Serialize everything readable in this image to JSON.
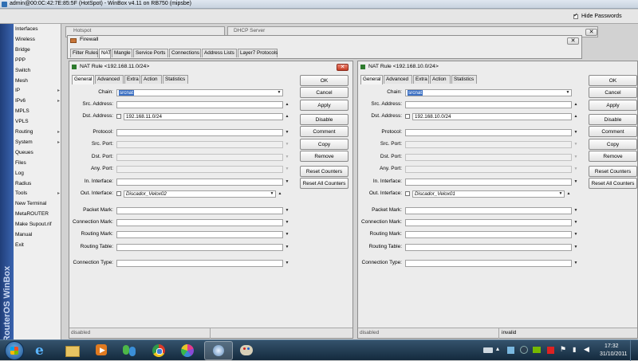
{
  "window": {
    "title": "admin@00:0C:42:7E:85:5F (HotSpot) - WinBox v4.11 on RB750 (mipsbe)",
    "hide_passwords": "Hide Passwords",
    "vertical_brand": "RouterOS WinBox"
  },
  "sidebar": {
    "items": [
      {
        "label": "Interfaces",
        "arrow": ""
      },
      {
        "label": "Wireless",
        "arrow": ""
      },
      {
        "label": "Bridge",
        "arrow": ""
      },
      {
        "label": "PPP",
        "arrow": ""
      },
      {
        "label": "Switch",
        "arrow": ""
      },
      {
        "label": "Mesh",
        "arrow": ""
      },
      {
        "label": "IP",
        "arrow": "▸"
      },
      {
        "label": "IPv6",
        "arrow": "▸"
      },
      {
        "label": "MPLS",
        "arrow": ""
      },
      {
        "label": "VPLS",
        "arrow": ""
      },
      {
        "label": "Routing",
        "arrow": "▸"
      },
      {
        "label": "System",
        "arrow": "▸"
      },
      {
        "label": "Queues",
        "arrow": ""
      },
      {
        "label": "Files",
        "arrow": ""
      },
      {
        "label": "Log",
        "arrow": ""
      },
      {
        "label": "Radius",
        "arrow": ""
      },
      {
        "label": "Tools",
        "arrow": "▸"
      },
      {
        "label": "New Terminal",
        "arrow": ""
      },
      {
        "label": "MetaROUTER",
        "arrow": ""
      },
      {
        "label": "Make Supout.rif",
        "arrow": ""
      },
      {
        "label": "Manual",
        "arrow": ""
      },
      {
        "label": "Exit",
        "arrow": ""
      }
    ]
  },
  "bg_windows": {
    "hotspot": "Hotspot",
    "dhcp": "DHCP Server"
  },
  "firewall": {
    "title": "Firewall",
    "tabs": [
      "Filter Rules",
      "NAT",
      "Mangle",
      "Service Ports",
      "Connections",
      "Address Lists",
      "Layer7 Protocols"
    ]
  },
  "nat_left": {
    "title": "NAT Rule <192.168.11.0/24>",
    "tabs": [
      "General",
      "Advanced",
      "Extra",
      "Action",
      "Statistics"
    ],
    "fields": {
      "chain": "srcnat",
      "src_address": "",
      "dst_address": "192.168.11.0/24",
      "protocol": "",
      "src_port": "",
      "dst_port": "",
      "any_port": "",
      "in_interface": "",
      "out_interface": "Discador_Velox02",
      "packet_mark": "",
      "connection_mark": "",
      "routing_mark": "",
      "routing_table": "",
      "connection_type": ""
    },
    "status": [
      "disabled",
      ""
    ]
  },
  "nat_right": {
    "title": "NAT Rule <192.168.10.0/24>",
    "tabs": [
      "General",
      "Advanced",
      "Extra",
      "Action",
      "Statistics"
    ],
    "fields": {
      "chain": "srcnat",
      "src_address": "",
      "dst_address": "192.168.10.0/24",
      "protocol": "",
      "src_port": "",
      "dst_port": "",
      "any_port": "",
      "in_interface": "",
      "out_interface": "Discador_Velox01",
      "packet_mark": "",
      "connection_mark": "",
      "routing_mark": "",
      "routing_table": "",
      "connection_type": ""
    },
    "status": [
      "disabled",
      "invalid"
    ]
  },
  "labels": {
    "chain": "Chain:",
    "src_address": "Src. Address:",
    "dst_address": "Dst. Address:",
    "protocol": "Protocol:",
    "src_port": "Src. Port:",
    "dst_port": "Dst. Port:",
    "any_port": "Any. Port:",
    "in_interface": "In. Interface:",
    "out_interface": "Out. Interface:",
    "packet_mark": "Packet Mark:",
    "connection_mark": "Connection Mark:",
    "routing_mark": "Routing Mark:",
    "routing_table": "Routing Table:",
    "connection_type": "Connection Type:"
  },
  "buttons": {
    "ok": "OK",
    "cancel": "Cancel",
    "apply": "Apply",
    "disable": "Disable",
    "comment": "Comment",
    "copy": "Copy",
    "remove": "Remove",
    "reset_counters": "Reset Counters",
    "reset_all_counters": "Reset All Counters"
  },
  "taskbar": {
    "time": "17:32",
    "date": "31/10/2011"
  },
  "colors": {
    "taskbar": "#1d3a52",
    "sidebar_brand": "#2a4c8c",
    "red_close": "#c43a22"
  }
}
